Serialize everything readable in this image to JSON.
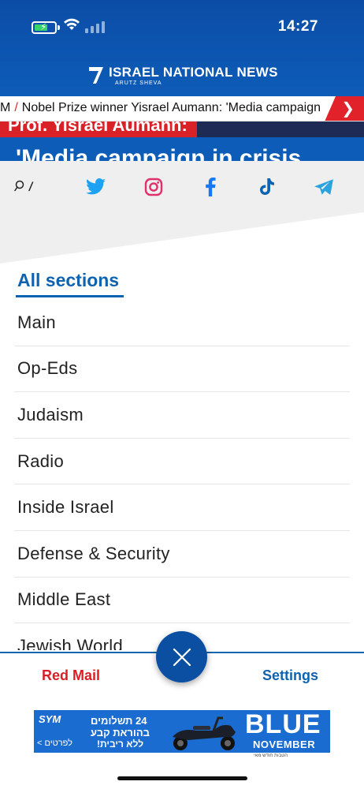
{
  "status_bar": {
    "time": "14:27",
    "icons": [
      "battery-charging-icon",
      "wifi-icon",
      "cellular-signal-icon"
    ]
  },
  "header": {
    "brand_name": "ISRAEL NATIONAL NEWS",
    "brand_sub": "ARUTZ SHEVA",
    "background": "#0b4da6"
  },
  "ticker": {
    "prefix": "M",
    "separator": "/",
    "headline": "Nobel Prize winner Yisrael Aumann: 'Media campaign",
    "arrow": "❯"
  },
  "peek": {
    "caption": "Prof. Yisrael Aumann:",
    "headline": "'Media campaign in crisis"
  },
  "social": {
    "items": [
      "search-icon",
      "twitter-icon",
      "instagram-icon",
      "facebook-icon",
      "tiktok-icon",
      "telegram-icon"
    ]
  },
  "sections": {
    "title": "All sections",
    "items": [
      {
        "label": "Main"
      },
      {
        "label": "Op-Eds"
      },
      {
        "label": "Judaism"
      },
      {
        "label": "Radio"
      },
      {
        "label": "Inside Israel"
      },
      {
        "label": "Defense & Security"
      },
      {
        "label": "Middle East"
      },
      {
        "label": "Jewish World"
      }
    ]
  },
  "bottom_bar": {
    "red_mail": "Red Mail",
    "settings": "Settings",
    "close": "close-icon"
  },
  "ad": {
    "brand": "SYM",
    "link": "< לפרטים",
    "line1": "24 תשלומים",
    "line2": "בהוראת קבע",
    "line3": "ללא ריבית!",
    "headline": "BLUE",
    "sub": "NOVEMBER",
    "fine_print": "הטבות חודש מאי"
  },
  "colors": {
    "accent_blue": "#0e63b1",
    "accent_red": "#d81f26"
  }
}
